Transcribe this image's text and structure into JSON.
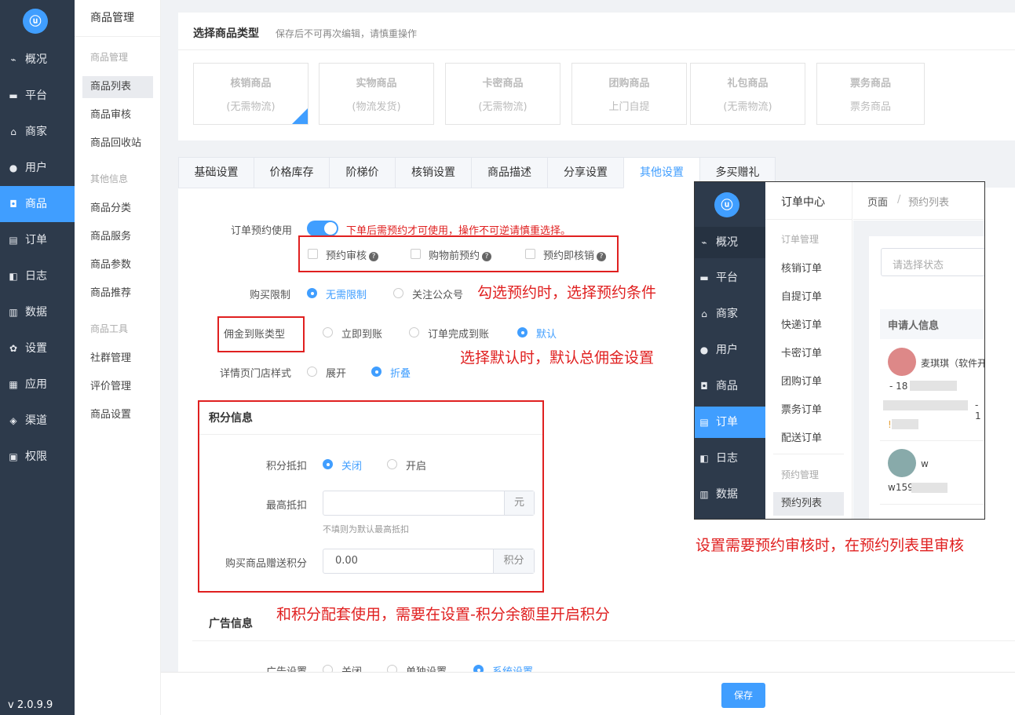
{
  "nav": {
    "items": [
      {
        "icon": "chart-icon",
        "glyph": "⌁",
        "label": "概况"
      },
      {
        "icon": "monitor-icon",
        "glyph": "▬",
        "label": "平台"
      },
      {
        "icon": "store-icon",
        "glyph": "⌂",
        "label": "商家"
      },
      {
        "icon": "user-icon",
        "glyph": "●",
        "label": "用户"
      },
      {
        "icon": "bag-icon",
        "glyph": "◘",
        "label": "商品"
      },
      {
        "icon": "clipboard-icon",
        "glyph": "▤",
        "label": "订单"
      },
      {
        "icon": "book-icon",
        "glyph": "◧",
        "label": "日志"
      },
      {
        "icon": "bar-chart-icon",
        "glyph": "▥",
        "label": "数据"
      },
      {
        "icon": "gear-icon",
        "glyph": "✿",
        "label": "设置"
      },
      {
        "icon": "apps-icon",
        "glyph": "▦",
        "label": "应用"
      },
      {
        "icon": "cube-icon",
        "glyph": "◈",
        "label": "渠道"
      },
      {
        "icon": "lock-icon",
        "glyph": "▣",
        "label": "权限"
      }
    ],
    "version": "v 2.0.9.9"
  },
  "subnav": {
    "title": "商品管理",
    "groups": [
      "商品管理",
      "其他信息",
      "商品工具"
    ],
    "items": [
      "商品列表",
      "商品审核",
      "商品回收站",
      "商品分类",
      "商品服务",
      "商品参数",
      "商品推荐",
      "社群管理",
      "评价管理",
      "商品设置"
    ]
  },
  "type_section": {
    "title": "选择商品类型",
    "hint": "保存后不可再次编辑，请慎重操作",
    "cards": [
      {
        "name": "核销商品",
        "desc": "(无需物流)"
      },
      {
        "name": "实物商品",
        "desc": "(物流发货)"
      },
      {
        "name": "卡密商品",
        "desc": "(无需物流)"
      },
      {
        "name": "团购商品",
        "desc": "上门自提"
      },
      {
        "name": "礼包商品",
        "desc": "(无需物流)"
      },
      {
        "name": "票务商品",
        "desc": "票务商品"
      }
    ]
  },
  "tabs": [
    "基础设置",
    "价格库存",
    "阶梯价",
    "核销设置",
    "商品描述",
    "分享设置",
    "其他设置",
    "多买赠礼"
  ],
  "form": {
    "reserve_label": "订单预约使用",
    "reserve_warning": "下单后需预约才可使用，操作不可逆请慎重选择。",
    "reserve_options": [
      "预约审核",
      "购物前预约",
      "预约即核销"
    ],
    "limit_label": "购买限制",
    "limit_options": [
      "无需限制",
      "关注公众号"
    ],
    "commission_label": "佣金到账类型",
    "commission_options": [
      "立即到账",
      "订单完成到账",
      "默认"
    ],
    "store_label": "详情页门店样式",
    "store_options": [
      "展开",
      "折叠"
    ]
  },
  "points": {
    "title": "积分信息",
    "deduct_label": "积分抵扣",
    "deduct_options": [
      "关闭",
      "开启"
    ],
    "max_label": "最高抵扣",
    "max_suffix": "元",
    "max_hint": "不填则为默认最高抵扣",
    "gift_label": "购买商品赠送积分",
    "gift_value": "0.00",
    "gift_suffix": "积分"
  },
  "ads": {
    "title": "广告信息",
    "label": "广告设置",
    "options": [
      "关闭",
      "单独设置",
      "系统设置"
    ]
  },
  "save_label": "保存",
  "notes": {
    "n1": "勾选预约时，选择预约条件",
    "n2": "选择默认时，默认总佣金设置",
    "n3": "和积分配套使用，需要在设置-积分余额里开启积分",
    "n4": "设置需要预约审核时，在预约列表里审核"
  },
  "overlay": {
    "nav": [
      "概况",
      "平台",
      "商家",
      "用户",
      "商品",
      "订单",
      "日志",
      "数据"
    ],
    "nav_icons": [
      "chart-icon",
      "monitor-icon",
      "store-icon",
      "user-icon",
      "bag-icon",
      "clipboard-icon",
      "book-icon",
      "bar-chart-icon"
    ],
    "nav_glyphs": [
      "⌁",
      "▬",
      "⌂",
      "●",
      "◘",
      "▤",
      "◧",
      "▥"
    ],
    "sub_title": "订单中心",
    "group1": "订单管理",
    "items": [
      "核销订单",
      "自提订单",
      "快递订单",
      "卡密订单",
      "团购订单",
      "票务订单",
      "配送订单"
    ],
    "group2": "预约管理",
    "active_item": "预约列表",
    "breadcrumb_root": "页面",
    "breadcrumb_sep": "/",
    "breadcrumb_current": "预约列表",
    "status_placeholder": "请选择状态",
    "applicant_header": "申请人信息",
    "row1_name": "麦琪琪（软件开",
    "row1_phone": "- 18",
    "row1_dash": "- 1",
    "row1_mark": "!",
    "row2_name": "w",
    "row2_id": "w159"
  }
}
